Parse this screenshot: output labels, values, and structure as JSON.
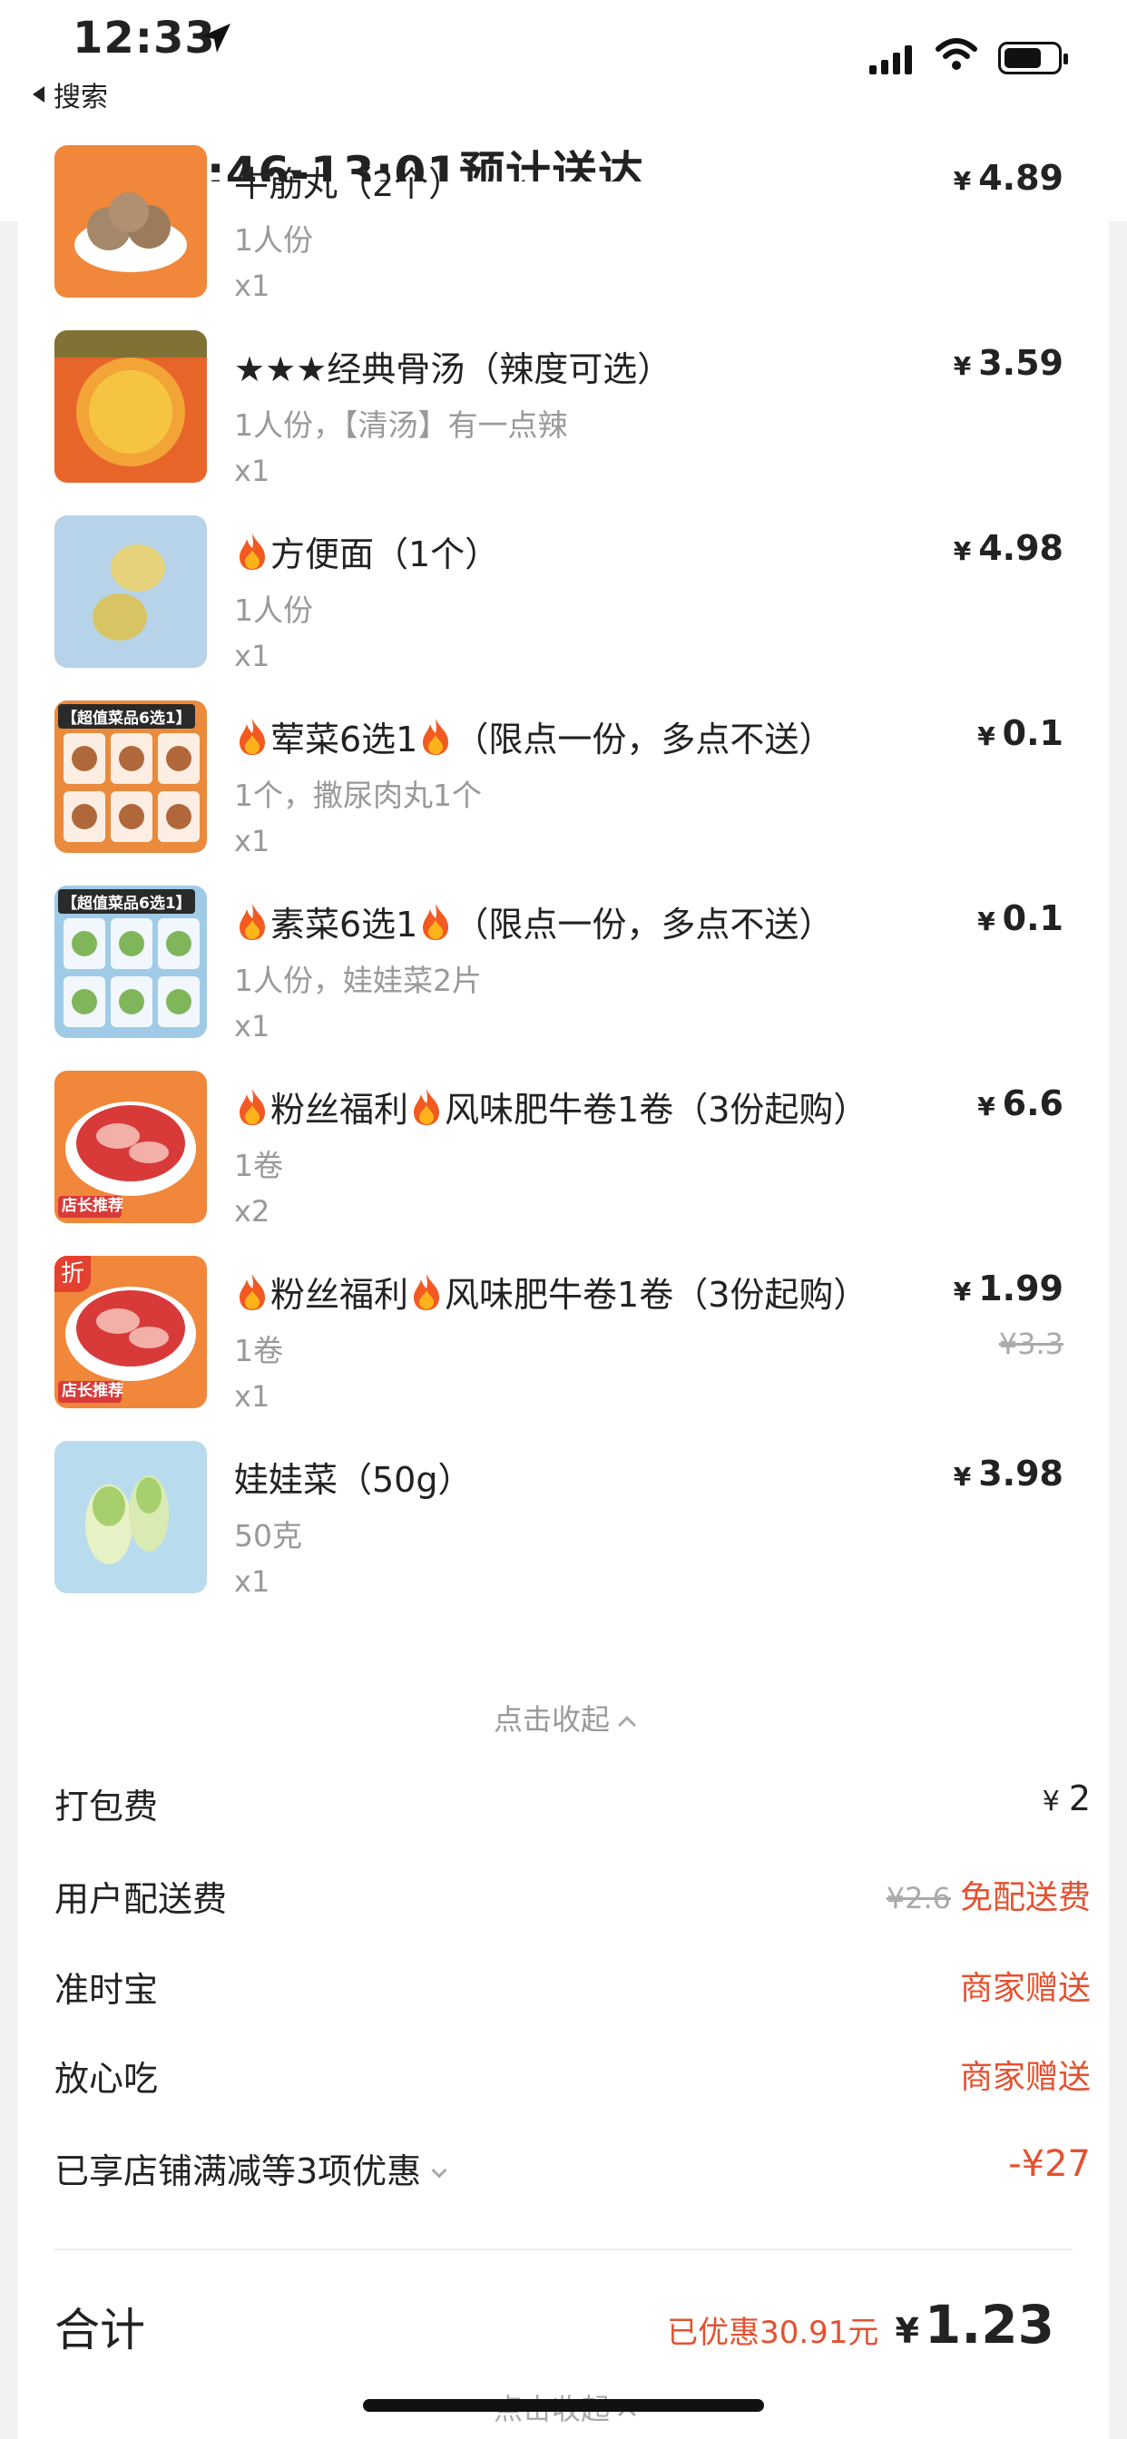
{
  "status_bar": {
    "time": "12:33",
    "back_app_label": "搜索"
  },
  "nav": {
    "title": "12:46-13:01预计送达"
  },
  "items": [
    {
      "name": "牛筋丸（2个）",
      "spec": "1人份",
      "qty": "x1",
      "price": "4.89",
      "thumb": "beef-balls"
    },
    {
      "name": "★★★经典骨汤（辣度可选）",
      "spec": "1人份，【清汤】有一点辣",
      "qty": "x1",
      "price": "3.59",
      "thumb": "bone-soup"
    },
    {
      "name_pre": "",
      "flame_before": true,
      "name": "方便面（1个）",
      "spec": "1人份",
      "qty": "x1",
      "price": "4.98",
      "thumb": "noodles"
    },
    {
      "flame_before": true,
      "name": "荤菜6选1",
      "flame_after": true,
      "name_suffix": "（限点一份，多点不送）",
      "spec": "1个，撒尿肉丸1个",
      "qty": "x1",
      "price": "0.1",
      "thumb": "meat-combo",
      "thumb_label": "【超值菜品6选1】"
    },
    {
      "flame_before": true,
      "name": "素菜6选1",
      "flame_after": true,
      "name_suffix": "（限点一份，多点不送）",
      "spec": "1人份，娃娃菜2片",
      "qty": "x1",
      "price": "0.1",
      "thumb": "veg-combo",
      "thumb_label": "【超值菜品6选1】"
    },
    {
      "flame_before": true,
      "name": "粉丝福利",
      "flame_after": true,
      "name_suffix": "风味肥牛卷1卷（3份起购）",
      "spec": "1卷",
      "qty": "x2",
      "price": "6.6",
      "thumb": "beef-roll",
      "thumb_label": "店长推荐"
    },
    {
      "flame_before": true,
      "name": "粉丝福利",
      "flame_after": true,
      "name_suffix": "风味肥牛卷1卷（3份起购）",
      "spec": "1卷",
      "qty": "x1",
      "price": "1.99",
      "orig_price": "¥3.3",
      "thumb": "beef-roll-discount",
      "thumb_label": "店长推荐",
      "thumb_badge": "折"
    },
    {
      "name": "娃娃菜（50g）",
      "spec": "50克",
      "qty": "x1",
      "price": "3.98",
      "thumb": "baby-cabbage"
    }
  ],
  "collapse_label": "点击收起",
  "fees": {
    "packing": {
      "label": "打包费",
      "value": "2"
    },
    "delivery": {
      "label": "用户配送费",
      "orig": "¥2.6",
      "value": "免配送费"
    },
    "ontime": {
      "label": "准时宝",
      "value": "商家赠送"
    },
    "safe": {
      "label": "放心吃",
      "value": "商家赠送"
    },
    "discount": {
      "label": "已享店铺满减等3项优惠",
      "value": "-¥27"
    }
  },
  "total": {
    "label": "合计",
    "saved": "已优惠30.91元",
    "value": "1.23"
  },
  "currency": "¥",
  "colors": {
    "accent": "#e4512f",
    "muted": "#999999"
  }
}
